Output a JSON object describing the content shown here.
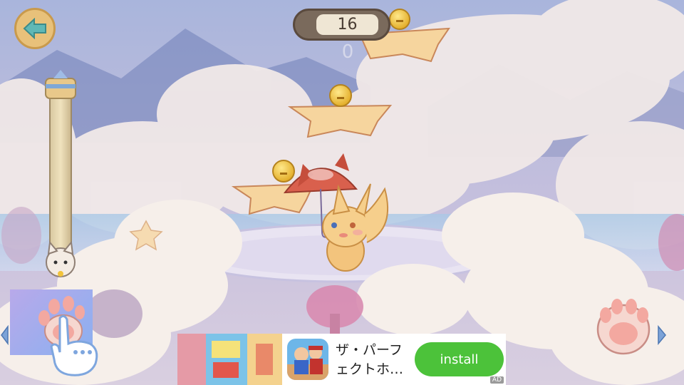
{
  "hud": {
    "score": "16",
    "sub_score": "0"
  },
  "ad": {
    "title": "ザ・パーフ\nェクトホ…",
    "install_label": "install",
    "ad_tag": "AD"
  },
  "icons": {
    "back": "back-arrow-icon",
    "bell": "bell-icon",
    "paw": "paw-icon",
    "cat_marker": "cat-head-icon"
  },
  "colors": {
    "sky": "#b9b6d6",
    "cloud": "#f3ece8",
    "star_platform": "#f5cf96",
    "bell": "#f2c33a",
    "install": "#4cc23a"
  }
}
